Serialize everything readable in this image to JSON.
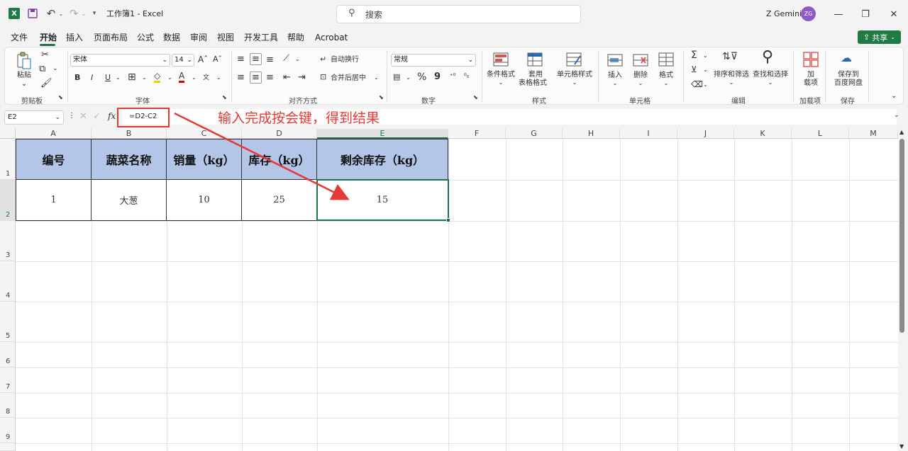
{
  "window": {
    "title": "工作簿1 - Excel",
    "search_placeholder": "搜索",
    "user_name": "Z Gemini",
    "user_initials": "ZG"
  },
  "menu": {
    "items": [
      "文件",
      "开始",
      "插入",
      "页面布局",
      "公式",
      "数据",
      "审阅",
      "视图",
      "开发工具",
      "帮助",
      "Acrobat"
    ],
    "active": "开始",
    "share_label": "共享"
  },
  "ribbon": {
    "clipboard": {
      "paste": "粘贴",
      "group": "剪贴板"
    },
    "font": {
      "name": "宋体",
      "size": "14",
      "bold": "B",
      "italic": "I",
      "underline": "U",
      "group": "字体"
    },
    "alignment": {
      "wrap": "自动换行",
      "merge": "合并后居中",
      "group": "对齐方式"
    },
    "number": {
      "format": "常规",
      "percent": "%",
      "comma": "9",
      "group": "数字"
    },
    "styles": {
      "conditional": "条件格式",
      "table_line1": "套用",
      "table_line2": "表格格式",
      "cell_styles": "单元格样式",
      "group": "样式"
    },
    "cells": {
      "insert": "插入",
      "delete": "删除",
      "format": "格式",
      "group": "单元格"
    },
    "editing": {
      "sum": "Σ",
      "sort": "排序和筛选",
      "find": "查找和选择",
      "group": "编辑"
    },
    "addins": {
      "line1": "加",
      "line2": "载项",
      "group": "加载项"
    },
    "save": {
      "line1": "保存到",
      "line2": "百度网盘",
      "group": "保存"
    }
  },
  "formula_bar": {
    "cell_ref": "E2",
    "fx": "fx",
    "formula": "=D2-C2"
  },
  "annotation": {
    "text": "输入完成按会键，得到结果",
    "color": "#e53935"
  },
  "sheet": {
    "columns": [
      "A",
      "B",
      "C",
      "D",
      "E",
      "F",
      "G",
      "H",
      "I",
      "J",
      "K",
      "L",
      "M"
    ],
    "rows": [
      "1",
      "2",
      "3",
      "4",
      "5",
      "6",
      "7",
      "8",
      "9"
    ],
    "selected_column": "E",
    "selected_row": "2",
    "table_headers": [
      "编号",
      "蔬菜名称",
      "销量（kg）",
      "库存（kg）",
      "剩余库存（kg）"
    ],
    "table_row": [
      "1",
      "大葱",
      "10",
      "25",
      "15"
    ],
    "header_fill": "#b4c6e7",
    "accent": "#217346"
  }
}
